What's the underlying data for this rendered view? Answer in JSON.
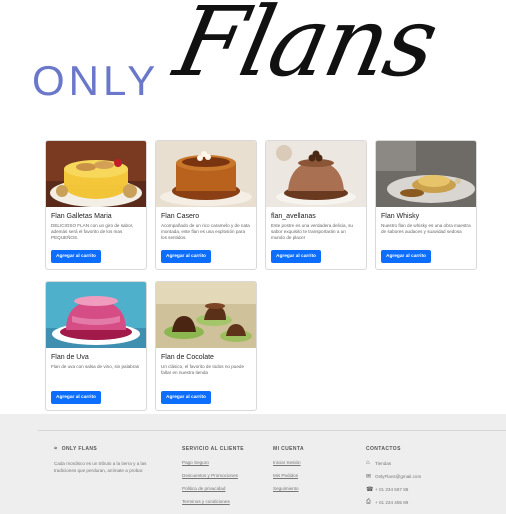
{
  "brand": {
    "prefix": "ONLY",
    "name": "Flans"
  },
  "products": [
    {
      "title": "Flan Galletas Maria",
      "description": "DELICIOSO FLAN con un giro de sabor, además será el favorito de los mas PEQUEÑOS.",
      "button": "Agregar al carrito",
      "image": "flan-galletas-maria-photo"
    },
    {
      "title": "Flan Casero",
      "description": "Acompañado de un rico caramelo y de nata montada, este flan es una explosión para los sentidos.",
      "button": "Agregar al carrito",
      "image": "flan-casero-photo"
    },
    {
      "title": "flan_avellanas",
      "description": "Este postre es una verdadera delicia, su sabor exquisito te transportarán a un mundo de placer",
      "button": "Agregar al carrito",
      "image": "flan-avellanas-photo"
    },
    {
      "title": "Flan Whisky",
      "description": "Nuestro flan de whisky es una obra maestra de sabores audaces y suavidad sedosa",
      "button": "Agregar al carrito",
      "image": "flan-whisky-photo"
    },
    {
      "title": "Flan de Uva",
      "description": "Flan de uva con salsa de vino, sin palabras",
      "button": "Agregar al carrito",
      "image": "flan-de-uva-photo"
    },
    {
      "title": "Flan de Cocolate",
      "description": "Un clásico, el favorito de todos no puede faltar en nuestra tienda",
      "button": "Agregar al carrito",
      "image": "flan-de-chocolate-photo"
    }
  ],
  "footer": {
    "about": {
      "heading": "ONLY FLANS",
      "text": "Cada mordisco es un tributo a la tierra y a las tradiciones que perduran, anímate a probar."
    },
    "service": {
      "heading": "SERVICIO AL CLIENTE",
      "links": [
        "Pago Seguro",
        "Descuentos y Promociones",
        "Politica de privacidad",
        "Terminos y condiciones"
      ]
    },
    "account": {
      "heading": "MI CUENTA",
      "links": [
        "Iniciar Sesión",
        "Mis Pedidos",
        "Seguimiento"
      ]
    },
    "contact": {
      "heading": "CONTACTOS",
      "items": [
        {
          "icon": "home-icon",
          "text": "Tiendas"
        },
        {
          "icon": "envelope-icon",
          "text": "OnlyFlans@gmail.com"
        },
        {
          "icon": "phone-icon",
          "text": "+ 01 234 567 88"
        },
        {
          "icon": "printer-icon",
          "text": "+ 01 234 455 89"
        }
      ]
    }
  },
  "colors": {
    "brand_accent": "#6b78c9",
    "button": "#0d6efd",
    "footer_bg": "#eeeeee"
  }
}
